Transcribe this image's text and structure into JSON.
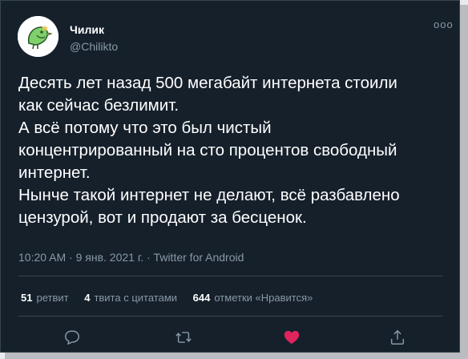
{
  "user": {
    "name": "Чилик",
    "handle": "@Chilikto"
  },
  "more_label": "ooo",
  "tweet": {
    "lines": [
      "Десять лет назад 500 мегабайт интернета стоили",
      "как сейчас безлимит.",
      "А всё потому что это был чистый",
      "концентрированный на сто процентов свободный",
      "интернет.",
      "Нынче такой интернет не делают, всё разбавлено",
      "цензурой, вот и продают за бесценок."
    ],
    "meta": "10:20 AM · 9 янв. 2021 г. · Twitter for Android"
  },
  "stats": {
    "retweets_count": "51",
    "retweets_label": "ретвит",
    "quotes_count": "4",
    "quotes_label": "твита с цитатами",
    "likes_count": "644",
    "likes_label": "отметки «Нравится»"
  },
  "actions": {
    "reply_icon": "reply-icon",
    "retweet_icon": "retweet-icon",
    "like_icon": "heart-icon",
    "share_icon": "share-icon"
  },
  "colors": {
    "background": "#15202b",
    "muted": "#8899a6",
    "like": "#e0245e",
    "avatar_accent": "#7fd16b"
  }
}
